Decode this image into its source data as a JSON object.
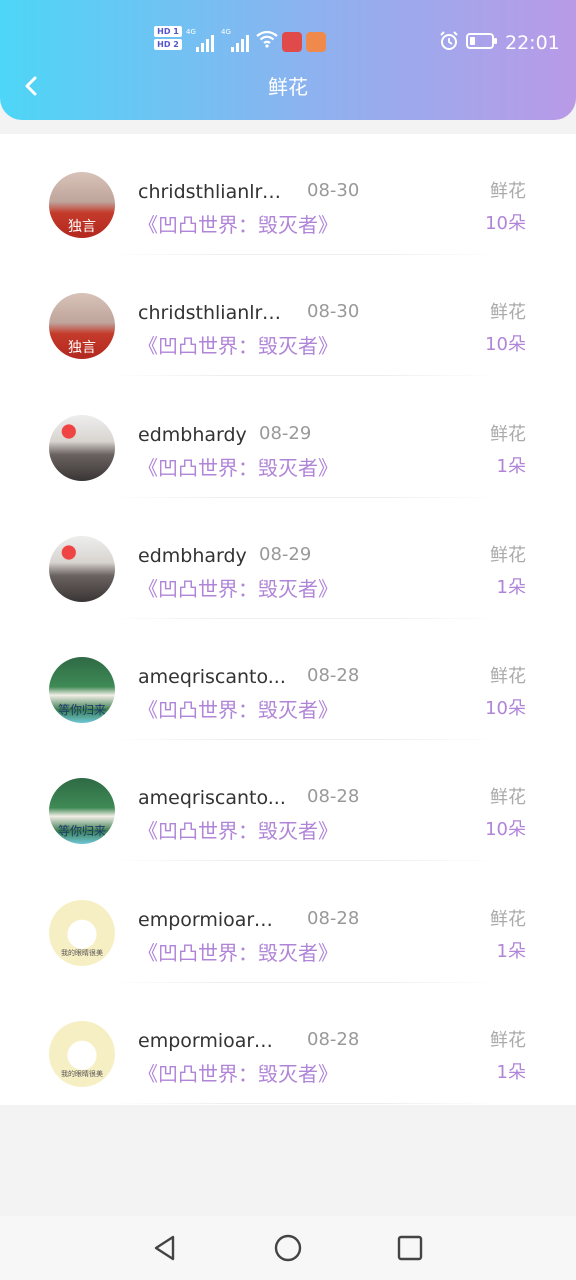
{
  "status_bar": {
    "time": "22:01",
    "hd1": "HD 1",
    "hd2": "HD 2",
    "net1": "4G",
    "net2": "4G",
    "icons": [
      "signal-icon",
      "wifi-icon",
      "app-notification-icon",
      "health-app-icon",
      "alarm-icon",
      "battery-icon"
    ]
  },
  "header": {
    "title": "鲜花",
    "back_icon": "back-arrow-icon"
  },
  "colors": {
    "accent": "#b085d8",
    "header_start": "#4dd6f7",
    "header_end": "#b99ae7"
  },
  "records": [
    {
      "name": "chridsthlianlro...",
      "date": "08-30",
      "game": "《凹凸世界：毁灭者》",
      "gift": "鲜花",
      "count": "10朵",
      "avatar": "avatar-red-hair"
    },
    {
      "name": "chridsthlianlro...",
      "date": "08-30",
      "game": "《凹凸世界：毁灭者》",
      "gift": "鲜花",
      "count": "10朵",
      "avatar": "avatar-red-hair"
    },
    {
      "name": "edmbhardy",
      "date": "08-29",
      "game": "《凹凸世界：毁灭者》",
      "gift": "鲜花",
      "count": "1朵",
      "avatar": "avatar-couple"
    },
    {
      "name": "edmbhardy",
      "date": "08-29",
      "game": "《凹凸世界：毁灭者》",
      "gift": "鲜花",
      "count": "1朵",
      "avatar": "avatar-couple"
    },
    {
      "name": "ameqriscanto...",
      "date": "08-28",
      "game": "《凹凸世界：毁灭者》",
      "gift": "鲜花",
      "count": "10朵",
      "avatar": "avatar-green"
    },
    {
      "name": "ameqriscanto...",
      "date": "08-28",
      "game": "《凹凸世界：毁灭者》",
      "gift": "鲜花",
      "count": "10朵",
      "avatar": "avatar-green"
    },
    {
      "name": "empormioarm...",
      "date": "08-28",
      "game": "《凹凸世界：毁灭者》",
      "gift": "鲜花",
      "count": "1朵",
      "avatar": "avatar-cartoon"
    },
    {
      "name": "empormioarm...",
      "date": "08-28",
      "game": "《凹凸世界：毁灭者》",
      "gift": "鲜花",
      "count": "1朵",
      "avatar": "avatar-cartoon"
    }
  ],
  "avatar_text": {
    "avatar-red-hair": "独言",
    "avatar-green": "等你归来",
    "avatar-cartoon": "我的眼睛很美"
  },
  "nav_bar": {
    "icons": [
      "back-triangle-icon",
      "home-circle-icon",
      "recents-square-icon"
    ]
  }
}
